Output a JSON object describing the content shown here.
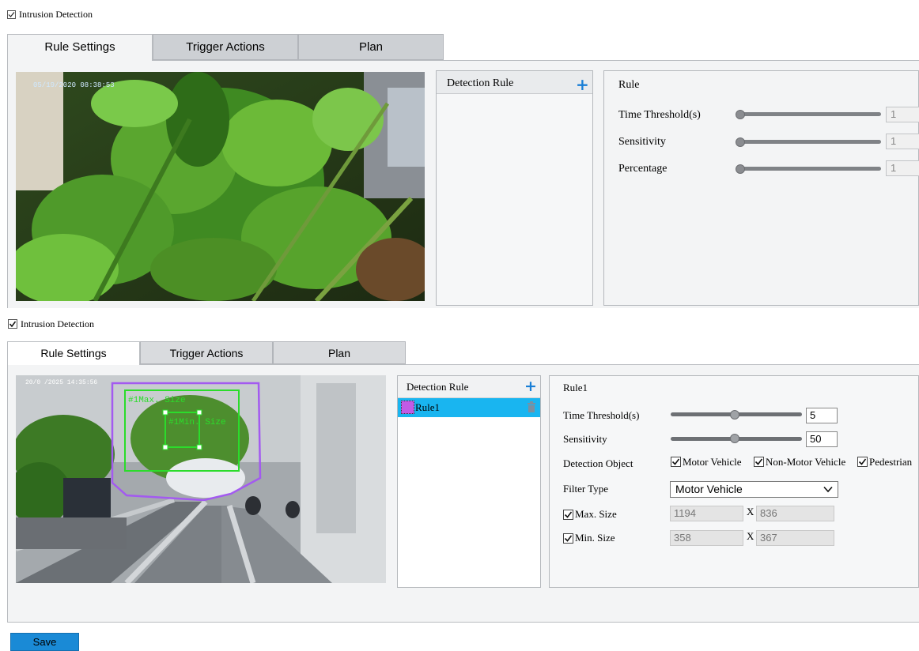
{
  "top": {
    "enable_label": "Intrusion Detection",
    "enabled": true,
    "tabs": [
      {
        "label": "Rule Settings",
        "active": true
      },
      {
        "label": "Trigger Actions",
        "active": false
      },
      {
        "label": "Plan",
        "active": false
      }
    ],
    "video_timestamp": "05/19/2020 08:38:53",
    "rule_list": {
      "header": "Detection Rule",
      "items": []
    },
    "rule_detail": {
      "title": "Rule",
      "sliders": [
        {
          "label": "Time Threshold(s)",
          "value": "1"
        },
        {
          "label": "Sensitivity",
          "value": "1"
        },
        {
          "label": "Percentage",
          "value": "1"
        }
      ]
    }
  },
  "bottom": {
    "enable_label": "Intrusion Detection",
    "enabled": true,
    "tabs": [
      {
        "label": "Rule Settings",
        "active": true
      },
      {
        "label": "Trigger Actions",
        "active": false
      },
      {
        "label": "Plan",
        "active": false
      }
    ],
    "video_timestamp": "20/0 /2025 14:35:56",
    "overlay": {
      "max_label": "#1Max. Size",
      "min_label": "#1Min. Size"
    },
    "rule_list": {
      "header": "Detection Rule",
      "items": [
        {
          "name": "Rule1",
          "color": "#c25be6",
          "selected": true
        }
      ]
    },
    "rule_detail": {
      "title": "Rule1",
      "time_threshold": {
        "label": "Time Threshold(s)",
        "value": "5"
      },
      "sensitivity": {
        "label": "Sensitivity",
        "value": "50"
      },
      "detection_object": {
        "label": "Detection Object",
        "options": [
          {
            "label": "Motor Vehicle",
            "checked": true
          },
          {
            "label": "Non-Motor Vehicle",
            "checked": true
          },
          {
            "label": "Pedestrian",
            "checked": true
          }
        ]
      },
      "filter_type": {
        "label": "Filter Type",
        "value": "Motor Vehicle"
      },
      "max_size": {
        "label": "Max. Size",
        "checked": true,
        "width": "1194",
        "sep": "X",
        "height": "836"
      },
      "min_size": {
        "label": "Min. Size",
        "checked": true,
        "width": "358",
        "sep": "X",
        "height": "367"
      }
    }
  },
  "save_label": "Save",
  "colors": {
    "accent": "#1a7fd6",
    "selection": "#19b5f0",
    "save": "#1a8ad6",
    "rule_color": "#c25be6"
  }
}
